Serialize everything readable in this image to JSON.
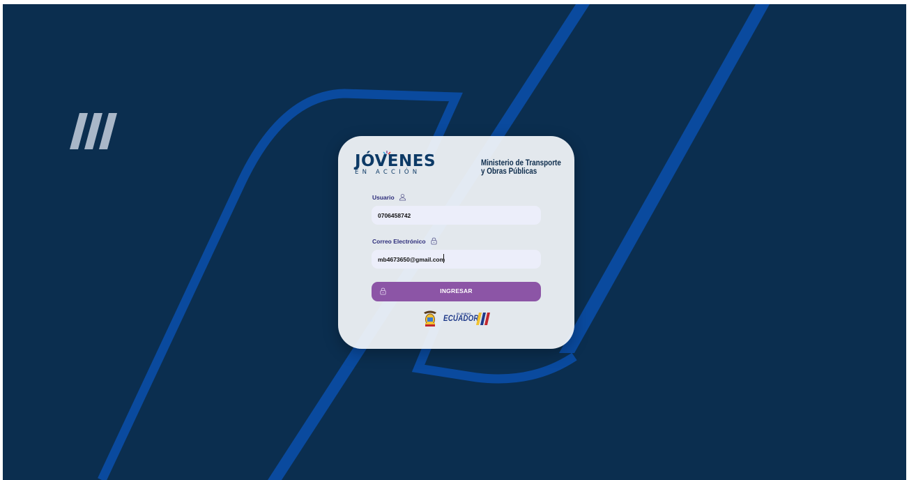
{
  "brand": {
    "logo_title": "JÓVENES",
    "logo_subtitle": "EN ACCIÓN",
    "ministry_line1": "Ministerio de Transporte",
    "ministry_line2": "y Obras Públicas"
  },
  "form": {
    "usuario_label": "Usuario",
    "usuario_value": "0706458742",
    "usuario_icon": "user-icon",
    "correo_label": "Correo Electrónico",
    "correo_value": "mb4673650@gmail.com",
    "correo_icon": "lock-icon",
    "submit_label": "INGRESAR",
    "submit_icon": "lock-icon"
  },
  "footer": {
    "ecuador_small": "EL NUEVO",
    "ecuador_big": "ECUADOR",
    "coat_icon": "coat-of-arms-icon"
  },
  "colors": {
    "background": "#0b2e4f",
    "accent_stripe": "#0a4a9e",
    "button": "#8c55a6",
    "text_dark": "#0d2c4c",
    "label": "#2c2c7a",
    "input_bg": "#eceefa"
  }
}
